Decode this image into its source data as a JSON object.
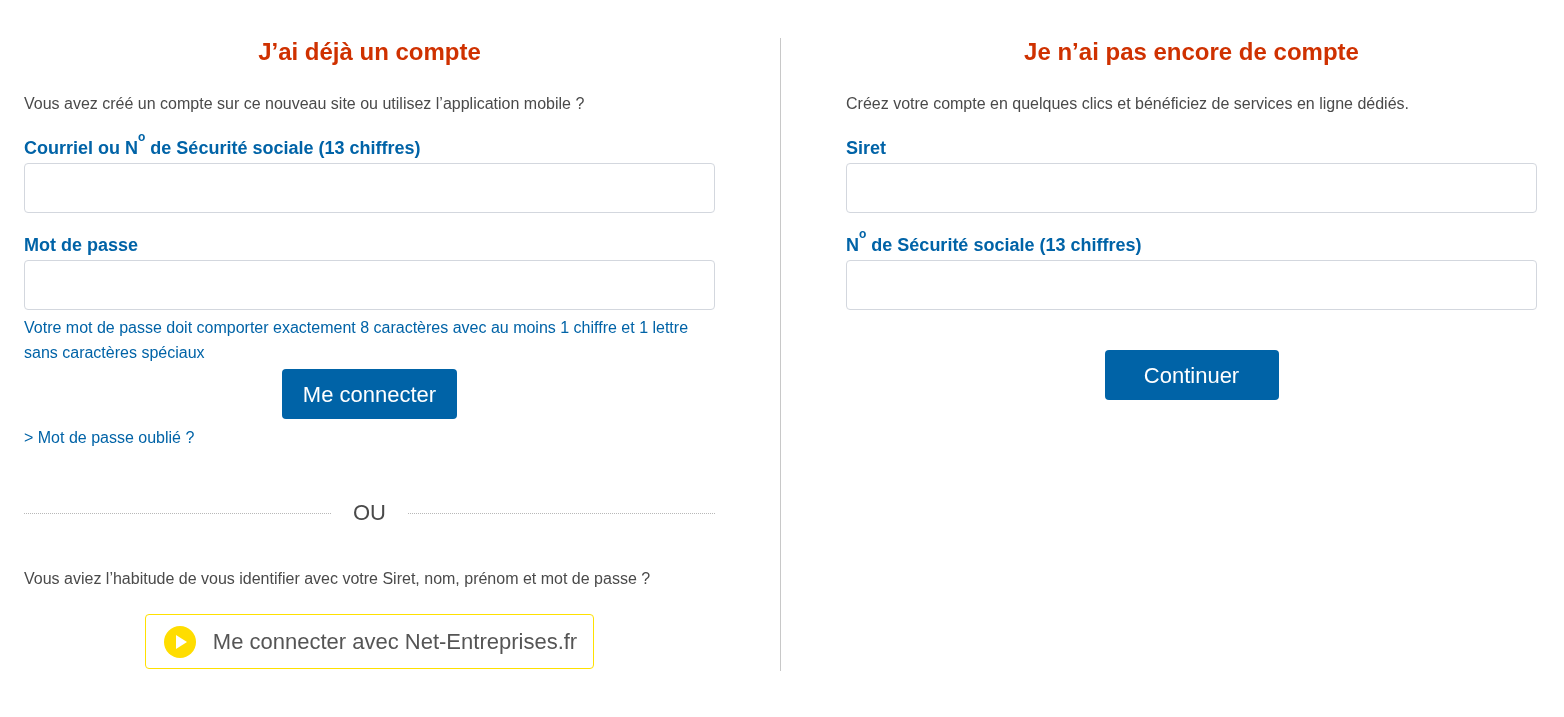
{
  "login": {
    "title": "J’ai déjà un compte",
    "intro": "Vous avez créé un compte sur ce nouveau site ou utilisez l’application mobile ?",
    "fields": [
      {
        "label": "Courriel ou N$^{o}$ de Sécurité sociale (13 chiffres)"
      },
      {
        "label": "Mot de passe",
        "hint": "Votre mot de passe doit comporter exactement 8 caractères avec au moins 1 chiffre et 1 lettre sans caractères spéciaux"
      }
    ],
    "submit_button": "Me connecter",
    "forgot_link": "> Mot de passe oublié ?",
    "separator": "OU",
    "legacy_text": "Vous aviez l’habitude de vous identifier avec votre Siret, nom, prénom et mot de passe ?",
    "legacy_button": "Me connecter avec Net-Entreprises.fr"
  },
  "signup": {
    "title": "Je n’ai pas encore de compte",
    "intro": "Créez votre compte en quelques clics et bénéficiez de services en ligne dédiés.",
    "fields": [
      {
        "label": "Siret"
      },
      {
        "label": "N$^{o}$ de Sécurité sociale (13 chiffres)"
      }
    ],
    "submit_button": "Continuer"
  }
}
